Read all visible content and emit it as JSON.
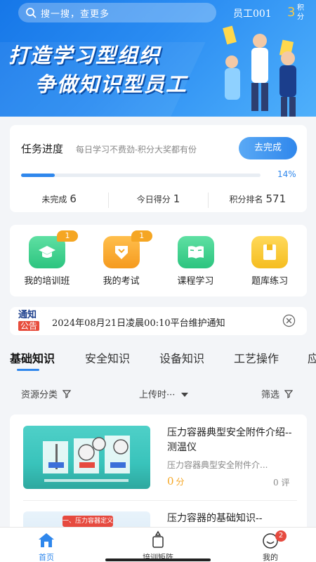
{
  "header": {
    "search_placeholder": "搜一搜，查更多",
    "user_name": "员工001",
    "points_value": "3",
    "points_label": "积分",
    "slogan_line1": "打造学习型组织",
    "slogan_line2": "争做知识型员工"
  },
  "task_card": {
    "title": "任务进度",
    "subtitle": "每日学习不费劲-积分大奖都有份",
    "button_label": "去完成",
    "progress_percent": 14,
    "progress_label": "14%",
    "stats": [
      {
        "label": "未完成",
        "value": "6"
      },
      {
        "label": "今日得分",
        "value": "1"
      },
      {
        "label": "积分排名",
        "value": "571"
      }
    ]
  },
  "quick_actions": [
    {
      "label": "我的培训班",
      "badge": "1",
      "icon": "graduation-cap-icon",
      "color": "#3dcf8e"
    },
    {
      "label": "我的考试",
      "badge": "1",
      "icon": "exam-icon",
      "color": "#f5a623"
    },
    {
      "label": "课程学习",
      "badge": "",
      "icon": "book-icon",
      "color": "#3dcf8e"
    },
    {
      "label": "题库练习",
      "badge": "",
      "icon": "question-bank-icon",
      "color": "#f7c531"
    }
  ],
  "notice": {
    "logo_top": "通知",
    "logo_bottom": "公告",
    "text": "2024年08月21日凌晨00:10平台维护通知"
  },
  "tabs": [
    "基础知识",
    "安全知识",
    "设备知识",
    "工艺操作",
    "应"
  ],
  "active_tab": 0,
  "filters": {
    "resource_type": "资源分类",
    "upload_time": "上传时···",
    "filter": "筛选"
  },
  "articles": [
    {
      "title": "压力容器典型安全附件介绍--测温仪",
      "description": "压力容器典型安全附件介...",
      "score": "0",
      "score_unit": "分",
      "comments": "0 评"
    },
    {
      "title": "压力容器的基础知识--",
      "thumb_caption": "一、压力容器定义"
    }
  ],
  "bottom_nav": [
    {
      "label": "首页",
      "icon": "home-icon",
      "active": true
    },
    {
      "label": "培训矩阵",
      "icon": "training-matrix-icon",
      "active": false
    },
    {
      "label": "我的",
      "icon": "profile-icon",
      "active": false,
      "badge": "2"
    }
  ],
  "colors": {
    "accent": "#2f87ec",
    "orange": "#f5a623",
    "green": "#3dcf8e"
  }
}
